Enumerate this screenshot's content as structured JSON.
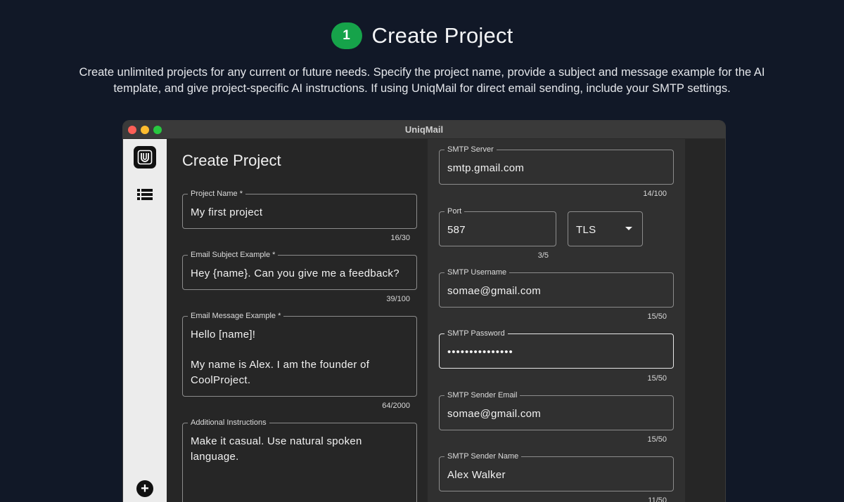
{
  "step": {
    "number": "1",
    "title": "Create Project",
    "description": "Create unlimited projects for any current or future needs. Specify the project name, provide a subject and message example for the AI template, and give project-specific AI instructions. If using UniqMail for direct email sending, include your SMTP settings."
  },
  "window": {
    "title": "UniqMail"
  },
  "sidebar": {
    "items": [
      {
        "icon": "uniqmail-logo-icon"
      },
      {
        "icon": "list-icon"
      },
      {
        "icon": "add-icon"
      }
    ]
  },
  "form": {
    "title": "Create Project",
    "project_name": {
      "label": "Project Name *",
      "value": "My first project",
      "counter": "16/30"
    },
    "email_subject": {
      "label": "Email Subject Example *",
      "value": "Hey {name}. Can you give me a feedback?",
      "counter": "39/100"
    },
    "email_message": {
      "label": "Email Message Example *",
      "value": "Hello [name]!\n\nMy name is Alex. I am the founder of CoolProject.",
      "counter": "64/2000"
    },
    "instructions": {
      "label": "Additional Instructions",
      "value": "Make it casual. Use natural spoken language."
    }
  },
  "smtp": {
    "server": {
      "label": "SMTP Server",
      "value": "smtp.gmail.com",
      "counter": "14/100"
    },
    "port": {
      "label": "Port",
      "value": "587",
      "counter": "3/5"
    },
    "security": {
      "value": "TLS"
    },
    "username": {
      "label": "SMTP Username",
      "value": "somae@gmail.com",
      "counter": "15/50"
    },
    "password": {
      "label": "SMTP Password",
      "value": "•••••••••••••••",
      "counter": "15/50"
    },
    "sender_email": {
      "label": "SMTP Sender Email",
      "value": "somae@gmail.com",
      "counter": "15/50"
    },
    "sender_name": {
      "label": "SMTP Sender Name",
      "value": "Alex Walker",
      "counter": "11/50"
    }
  },
  "colors": {
    "page_bg": "#111827",
    "badge": "#16a34a",
    "window_bg": "#262626",
    "sidebar_bg": "#ececec"
  }
}
